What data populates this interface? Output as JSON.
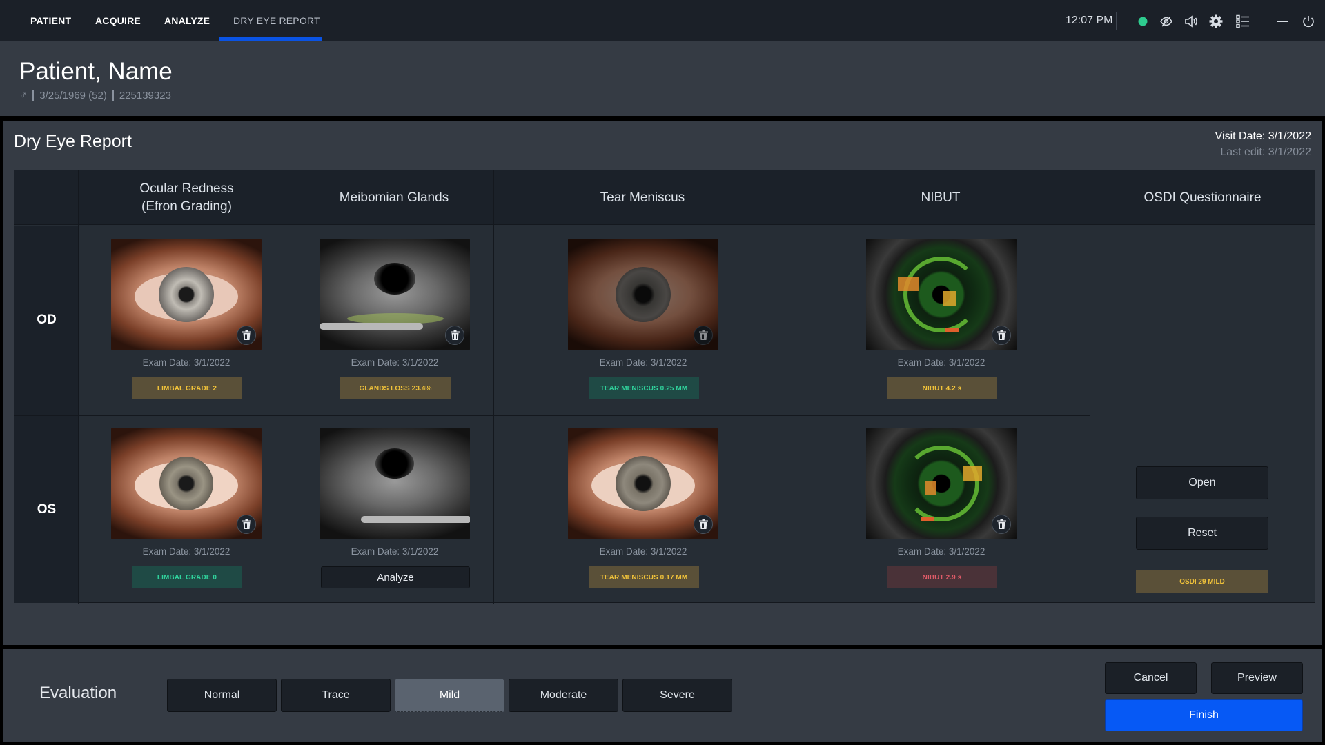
{
  "nav": {
    "tabs": [
      {
        "label": "PATIENT",
        "active": false
      },
      {
        "label": "ACQUIRE",
        "active": false
      },
      {
        "label": "ANALYZE",
        "active": false
      },
      {
        "label": "DRY EYE REPORT",
        "active": true
      }
    ],
    "clock": "12:07 PM",
    "status_color": "#2ecc8f",
    "icons": [
      "status-dot",
      "eye-off-icon",
      "speaker-icon",
      "gear-icon",
      "list-icon",
      "minimize-icon",
      "power-icon"
    ],
    "accent_color": "#0a53e4"
  },
  "patient": {
    "name": "Patient, Name",
    "sex_symbol": "♂",
    "dob": "3/25/1969 (52)",
    "id": "225139323"
  },
  "report": {
    "title": "Dry Eye Report",
    "visit_date": "Visit Date: 3/1/2022",
    "last_edit": "Last edit: 3/1/2022",
    "columns": [
      {
        "line1": "Ocular Redness",
        "line2": "(Efron Grading)"
      },
      {
        "line1": "Meibomian Glands"
      },
      {
        "line1": "Tear Meniscus"
      },
      {
        "line1": "NIBUT"
      },
      {
        "line1": "OSDI Questionnaire"
      }
    ],
    "rows": [
      {
        "label": "OD",
        "ocular_redness": {
          "exam_date": "Exam Date: 3/1/2022",
          "result": "LIMBAL GRADE 2",
          "status": "yellow"
        },
        "meibomian": {
          "exam_date": "Exam Date: 3/1/2022",
          "result": "GLANDS LOSS 23.4%",
          "status": "yellow"
        },
        "tear_meniscus": {
          "exam_date": "Exam Date: 3/1/2022",
          "result": "TEAR MENISCUS 0.25 MM",
          "status": "green"
        },
        "nibut": {
          "exam_date": "Exam Date: 3/1/2022",
          "result": "NIBUT 4.2 s",
          "status": "yellow"
        }
      },
      {
        "label": "OS",
        "ocular_redness": {
          "exam_date": "Exam Date: 3/1/2022",
          "result": "LIMBAL GRADE 0",
          "status": "green"
        },
        "meibomian": {
          "exam_date": "Exam Date: 3/1/2022",
          "action": "Analyze"
        },
        "tear_meniscus": {
          "exam_date": "Exam Date: 3/1/2022",
          "result": "TEAR MENISCUS 0.17 MM",
          "status": "yellow"
        },
        "nibut": {
          "exam_date": "Exam Date: 3/1/2022",
          "result": "NIBUT 2.9 s",
          "status": "red"
        }
      }
    ],
    "osdi": {
      "open_label": "Open",
      "reset_label": "Reset",
      "result": "OSDI 29 MILD"
    }
  },
  "evaluation": {
    "label": "Evaluation",
    "options": [
      "Normal",
      "Trace",
      "Mild",
      "Moderate",
      "Severe"
    ],
    "selected": "Mild"
  },
  "actions": {
    "cancel": "Cancel",
    "preview": "Preview",
    "finish": "Finish"
  }
}
